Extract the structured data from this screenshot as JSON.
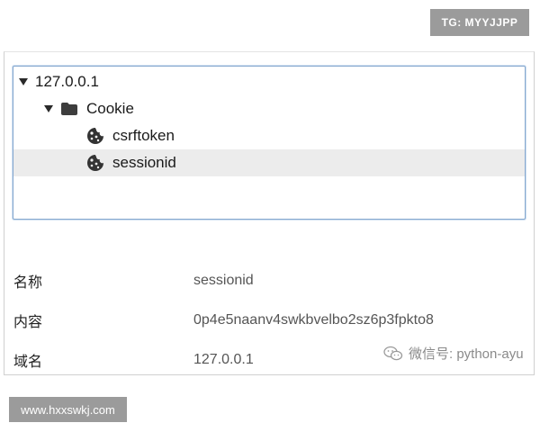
{
  "overlays": {
    "tg_badge": "TG: MYYJJPP",
    "site_badge": "www.hxxswkj.com",
    "wechat_watermark": "微信号: python-ayu"
  },
  "tree": {
    "host": {
      "label": "127.0.0.1",
      "expanded": true,
      "icon": "disclosure-triangle"
    },
    "folder": {
      "label": "Cookie",
      "expanded": true,
      "icon": "folder-icon"
    },
    "cookies": [
      {
        "label": "csrftoken",
        "icon": "cookie-icon",
        "selected": false
      },
      {
        "label": "sessionid",
        "icon": "cookie-icon",
        "selected": true
      }
    ]
  },
  "details": {
    "rows": [
      {
        "label": "名称",
        "value": "sessionid"
      },
      {
        "label": "内容",
        "value": "0p4e5naanv4swkbvelbo2sz6p3fpkto8"
      },
      {
        "label": "域名",
        "value": "127.0.0.1"
      }
    ]
  },
  "colors": {
    "selection": "#ececec",
    "focus_border": "#86a8cf",
    "badge_bg": "#9b9b9b"
  }
}
